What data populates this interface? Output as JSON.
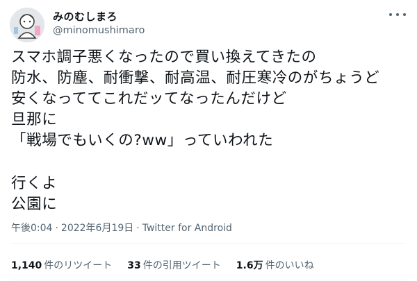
{
  "author": {
    "display_name": "みのむしまろ",
    "handle": "@minomushimaro"
  },
  "tweet": {
    "lines": [
      "スマホ調子悪くなったので買い換えてきたの",
      "防水、防塵、耐衝撃、耐高温、耐圧寒冷のがちょうど",
      "安くなっててこれだッてなったんだけど",
      "旦那に",
      "「戦場でもいくの?ww」っていわれた",
      "",
      "行くよ",
      "公園に"
    ],
    "time": "午後0:04",
    "date": "2022年6月19日",
    "separator": "·",
    "source": "Twitter for Android"
  },
  "stats": {
    "retweets_count": "1,140",
    "retweets_label": "件のリツイート",
    "quotes_count": "33",
    "quotes_label": "件の引用ツイート",
    "likes_count": "1.6万",
    "likes_label": "件のいいね"
  },
  "icons": {
    "more": "more-horizontal-icon"
  },
  "colors": {
    "text": "#0f1419",
    "secondary": "#536471",
    "divider": "#eff3f4"
  }
}
